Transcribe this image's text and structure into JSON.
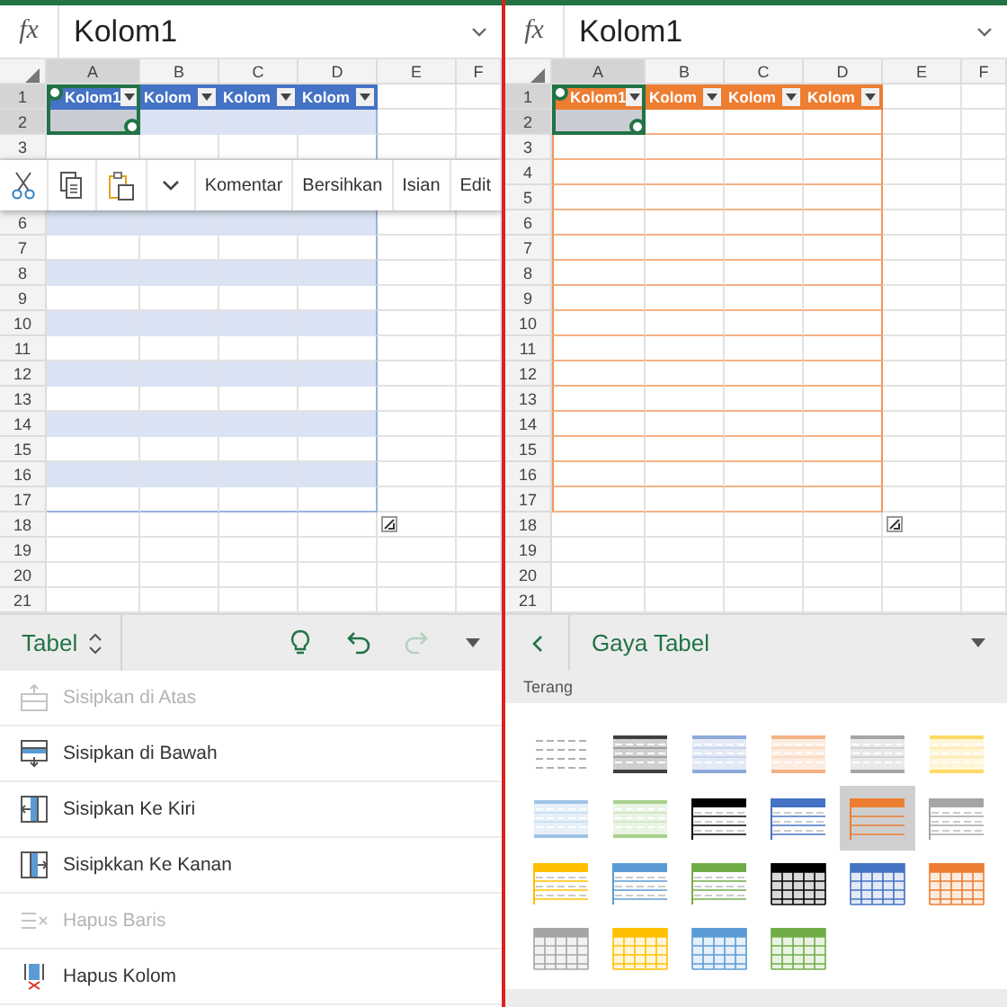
{
  "panels": [
    {
      "formula_bar": {
        "label": "fx",
        "value": "Kolom1"
      },
      "sheet": {
        "columns": [
          {
            "label": "A",
            "selected": true
          },
          {
            "label": "B",
            "selected": false
          },
          {
            "label": "C",
            "selected": false
          },
          {
            "label": "D",
            "selected": false
          },
          {
            "label": "E",
            "selected": false
          },
          {
            "label": "F",
            "selected": false
          }
        ],
        "rows": [
          {
            "label": "1",
            "selected": true
          },
          {
            "label": "2",
            "selected": true
          },
          {
            "label": "3",
            "selected": false
          },
          {
            "label": "6",
            "selected": false
          },
          {
            "label": "7",
            "selected": false
          },
          {
            "label": "8",
            "selected": false
          },
          {
            "label": "9",
            "selected": false
          },
          {
            "label": "10",
            "selected": false
          },
          {
            "label": "11",
            "selected": false
          },
          {
            "label": "12",
            "selected": false
          },
          {
            "label": "13",
            "selected": false
          },
          {
            "label": "14",
            "selected": false
          },
          {
            "label": "15",
            "selected": false
          },
          {
            "label": "16",
            "selected": false
          },
          {
            "label": "17",
            "selected": false
          },
          {
            "label": "18",
            "selected": false
          },
          {
            "label": "19",
            "selected": false
          },
          {
            "label": "20",
            "selected": false
          },
          {
            "label": "21",
            "selected": false
          }
        ],
        "table": {
          "color": "#4472c4",
          "banded": true,
          "headers": [
            "Kolom1",
            "Kolom",
            "Kolom",
            "Kolom"
          ]
        }
      },
      "context_menu": {
        "items": [
          {
            "kind": "cut"
          },
          {
            "kind": "copy"
          },
          {
            "kind": "paste"
          },
          {
            "kind": "more"
          },
          {
            "kind": "text",
            "label": "Komentar"
          },
          {
            "kind": "text",
            "label": "Bersihkan"
          },
          {
            "kind": "text",
            "label": "Isian"
          },
          {
            "kind": "text",
            "label": "Edit"
          }
        ]
      },
      "toolbar": {
        "kind": "menu",
        "title": "Tabel",
        "buttons": [
          {
            "kind": "idea",
            "disabled": false
          },
          {
            "kind": "undo",
            "disabled": false
          },
          {
            "kind": "redo",
            "disabled": true
          }
        ]
      },
      "commands": [
        {
          "kind": "insert-above",
          "label": "Sisipkan di Atas",
          "disabled": true
        },
        {
          "kind": "insert-below",
          "label": "Sisipkan di Bawah",
          "disabled": false
        },
        {
          "kind": "insert-left",
          "label": "Sisipkan Ke Kiri",
          "disabled": false
        },
        {
          "kind": "insert-right",
          "label": "Sisipkkan Ke Kanan",
          "disabled": false
        },
        {
          "kind": "delete-row",
          "label": "Hapus Baris",
          "disabled": true
        },
        {
          "kind": "delete-column",
          "label": "Hapus Kolom",
          "disabled": false
        }
      ]
    },
    {
      "formula_bar": {
        "label": "fx",
        "value": "Kolom1"
      },
      "sheet": {
        "columns": [
          {
            "label": "A",
            "selected": true
          },
          {
            "label": "B",
            "selected": false
          },
          {
            "label": "C",
            "selected": false
          },
          {
            "label": "D",
            "selected": false
          },
          {
            "label": "E",
            "selected": false
          },
          {
            "label": "F",
            "selected": false
          }
        ],
        "rows": [
          {
            "label": "1",
            "selected": true
          },
          {
            "label": "2",
            "selected": true
          },
          {
            "label": "3",
            "selected": false
          },
          {
            "label": "4",
            "selected": false
          },
          {
            "label": "5",
            "selected": false
          },
          {
            "label": "6",
            "selected": false
          },
          {
            "label": "7",
            "selected": false
          },
          {
            "label": "8",
            "selected": false
          },
          {
            "label": "9",
            "selected": false
          },
          {
            "label": "10",
            "selected": false
          },
          {
            "label": "11",
            "selected": false
          },
          {
            "label": "12",
            "selected": false
          },
          {
            "label": "13",
            "selected": false
          },
          {
            "label": "14",
            "selected": false
          },
          {
            "label": "15",
            "selected": false
          },
          {
            "label": "16",
            "selected": false
          },
          {
            "label": "17",
            "selected": false
          },
          {
            "label": "18",
            "selected": false
          },
          {
            "label": "19",
            "selected": false
          },
          {
            "label": "20",
            "selected": false
          },
          {
            "label": "21",
            "selected": false
          }
        ],
        "table": {
          "color": "#ed7d31",
          "banded": false,
          "headers": [
            "Kolom1",
            "Kolom",
            "Kolom",
            "Kolom"
          ]
        }
      },
      "toolbar": {
        "kind": "back",
        "title": "Gaya Tabel"
      },
      "gallery": {
        "section": "Terang",
        "styles": [
          {
            "kind": "plain",
            "color": "#b0b0b0",
            "selected": false
          },
          {
            "kind": "lines",
            "color": "#404040",
            "selected": false
          },
          {
            "kind": "lines",
            "color": "#8eaadb",
            "selected": false
          },
          {
            "kind": "lines",
            "color": "#f4b183",
            "selected": false
          },
          {
            "kind": "lines",
            "color": "#a5a5a5",
            "selected": false
          },
          {
            "kind": "lines",
            "color": "#ffd966",
            "selected": false
          },
          {
            "kind": "lines",
            "color": "#9dc3e6",
            "selected": false
          },
          {
            "kind": "lines",
            "color": "#a9d18e",
            "selected": false
          },
          {
            "kind": "header",
            "color": "#000000",
            "selected": false
          },
          {
            "kind": "header",
            "color": "#4472c4",
            "selected": false
          },
          {
            "kind": "header",
            "color": "#ed7d31",
            "selected": true
          },
          {
            "kind": "header",
            "color": "#a5a5a5",
            "selected": false
          },
          {
            "kind": "header",
            "color": "#ffc000",
            "selected": false
          },
          {
            "kind": "header",
            "color": "#5b9bd5",
            "selected": false
          },
          {
            "kind": "header",
            "color": "#70ad47",
            "selected": false
          },
          {
            "kind": "grid",
            "color": "#000000",
            "selected": false
          },
          {
            "kind": "grid",
            "color": "#4472c4",
            "selected": false
          },
          {
            "kind": "grid",
            "color": "#ed7d31",
            "selected": false
          },
          {
            "kind": "grid",
            "color": "#a5a5a5",
            "selected": false
          },
          {
            "kind": "grid",
            "color": "#ffc000",
            "selected": false
          },
          {
            "kind": "grid",
            "color": "#5b9bd5",
            "selected": false
          },
          {
            "kind": "grid",
            "color": "#70ad47",
            "selected": false
          }
        ]
      }
    }
  ]
}
